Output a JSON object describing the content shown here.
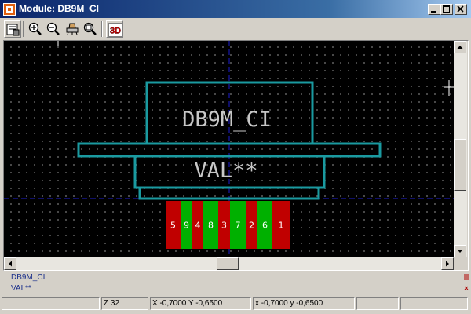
{
  "window": {
    "title": "Module: DB9M_CI",
    "controls": [
      "minimize",
      "maximize",
      "close"
    ]
  },
  "toolbar": {
    "buttons": [
      {
        "name": "options",
        "icon": "module-options-icon"
      },
      {
        "name": "zoom-in",
        "icon": "zoom-in-icon"
      },
      {
        "name": "zoom-out",
        "icon": "zoom-out-icon"
      },
      {
        "name": "redraw",
        "icon": "redraw-icon"
      },
      {
        "name": "zoom-fit",
        "icon": "zoom-auto-icon"
      },
      {
        "name": "3d-view",
        "icon": "3d-display-icon",
        "label": "3D"
      }
    ]
  },
  "footprint": {
    "reference": "DB9M_CI",
    "value": "VAL**",
    "outline_color": "#1a9aa0",
    "text_color": "#c8c8c8",
    "pad_colors": {
      "front": "#00b000",
      "back": "#c00000"
    },
    "pads": [
      "5",
      "9",
      "4",
      "8",
      "3",
      "7",
      "2",
      "6",
      "1"
    ]
  },
  "info_panel": {
    "line1": "DB9M_CI",
    "line2": "VAL**"
  },
  "status": {
    "zoom": "Z 32",
    "abs_coords": "X -0,7000  Y -0,6500",
    "rel_coords": "x -0,7000  y -0,6500"
  },
  "colors": {
    "title_start": "#0a246a",
    "title_end": "#a6caf0",
    "canvas_bg": "#000000",
    "axis_color": "#1e1ed0",
    "info_text": "#1a2f8a"
  }
}
